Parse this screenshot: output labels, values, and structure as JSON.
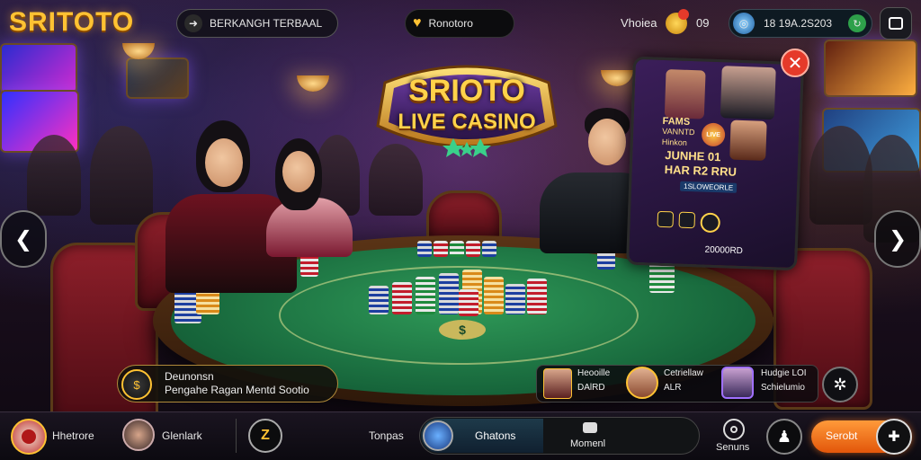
{
  "brand": "SRITOTO",
  "header": {
    "announce_label": "BERKANGH TERBAAL",
    "center_label": "Ronotoro",
    "user_label": "Vhoiea",
    "coins": "09",
    "balance": "18 19A.2S203"
  },
  "logo": {
    "line1": "SRIOTO",
    "line2": "LIVE CASINO"
  },
  "promo": {
    "line1": "FAMS",
    "line2": "VANNTD",
    "line3": "Hinkon",
    "mid_label": "LIVE",
    "line4": "JUNHE 01",
    "line5": "HAR R2 RRU",
    "line6": "1SLOWEORLE",
    "line7": "20000RD"
  },
  "info_box": {
    "line1": "Deunonsn",
    "line2": "Pengahe Ragan Mentd Sootio"
  },
  "players": [
    {
      "name": "Heooille",
      "value": "DAlRD"
    },
    {
      "name": "Cetriellaw",
      "value": "ALR"
    },
    {
      "name": "Hudgie LOI",
      "value": "Schielumio"
    }
  ],
  "bottom": {
    "profile_label": "Hhetrore",
    "friend_label": "Glenlark",
    "mid_label": "Tonpas",
    "tab_active": "Ghatons",
    "tab_second": "Momenl",
    "right_label": "Senuns",
    "action_label": "Serobt"
  },
  "colors": {
    "brand": "#ffc233",
    "felt": "#1f7c46",
    "accent_orange": "#ff7a1a",
    "close_red": "#e53a2a"
  }
}
